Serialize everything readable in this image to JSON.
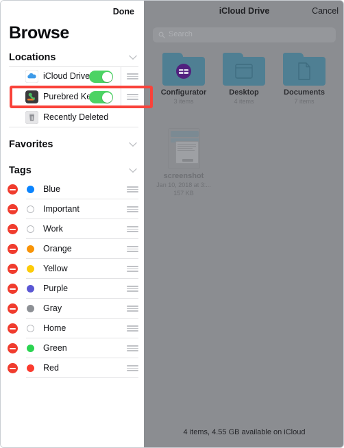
{
  "sidebar": {
    "done_label": "Done",
    "title": "Browse",
    "sections": [
      {
        "label": "Locations",
        "chevron": "chevron-down-icon"
      },
      {
        "label": "Favorites",
        "chevron": "chevron-down-icon"
      },
      {
        "label": "Tags",
        "chevron": "chevron-down-icon"
      }
    ],
    "locations": [
      {
        "label": "iCloud Drive",
        "icon": "icloud-drive-icon",
        "toggle": "on",
        "grip": "drag-handle-icon"
      },
      {
        "label": "Purebred Ke...",
        "icon": "purebred-app-icon",
        "toggle": "on",
        "grip": "drag-handle-icon"
      },
      {
        "label": "Recently Deleted",
        "icon": "trash-icon",
        "toggle": "none",
        "grip": "none"
      }
    ],
    "tags": [
      {
        "label": "Blue",
        "color": "#0b84fe",
        "hollow": false
      },
      {
        "label": "Important",
        "color": "#ffffff",
        "hollow": true
      },
      {
        "label": "Work",
        "color": "#ffffff",
        "hollow": true
      },
      {
        "label": "Orange",
        "color": "#f89406",
        "hollow": false
      },
      {
        "label": "Yellow",
        "color": "#fdcb08",
        "hollow": false
      },
      {
        "label": "Purple",
        "color": "#5a57d4",
        "hollow": false
      },
      {
        "label": "Gray",
        "color": "#8d9095",
        "hollow": false
      },
      {
        "label": "Home",
        "color": "#ffffff",
        "hollow": true
      },
      {
        "label": "Green",
        "color": "#2bd451",
        "hollow": false
      },
      {
        "label": "Red",
        "color": "#fb3b2f",
        "hollow": false
      }
    ],
    "remove_button_icon": "minus-circle-icon"
  },
  "files": {
    "nav_title": "iCloud Drive",
    "cancel_label": "Cancel",
    "search_placeholder": "Search",
    "search_icon": "search-icon",
    "items": [
      {
        "name": "Configurator",
        "sub1": "3 items",
        "sub2": "",
        "icon": "folder-configurator-icon",
        "kind": "folder"
      },
      {
        "name": "Desktop",
        "sub1": "4 items",
        "sub2": "",
        "icon": "folder-desktop-icon",
        "kind": "folder"
      },
      {
        "name": "Documents",
        "sub1": "7 items",
        "sub2": "",
        "icon": "folder-documents-icon",
        "kind": "folder"
      },
      {
        "name": "screenshot",
        "sub1": "Jan 10, 2018 at 3:...",
        "sub2": "157 KB",
        "icon": "screenshot-thumbnail",
        "kind": "file"
      }
    ],
    "status": "4 items, 4.55 GB available on iCloud"
  },
  "annotation": {
    "highlight_target": "purebred-location-row",
    "color": "#f9423a"
  },
  "colors": {
    "toggle_on": "#4cd364",
    "remove_red": "#f03c2e",
    "folder_blue": "#4f7f93",
    "overlay_gray": "#8b8d91",
    "highlight_red": "#f9423a"
  }
}
